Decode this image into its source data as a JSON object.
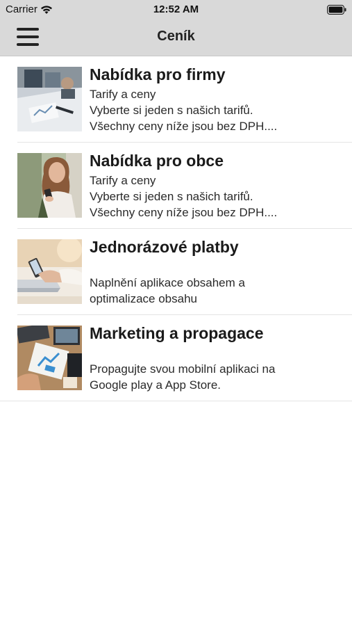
{
  "status_bar": {
    "carrier": "Carrier",
    "time": "12:52 AM"
  },
  "nav": {
    "title": "Ceník",
    "menu_icon": "hamburger-menu-icon"
  },
  "items": [
    {
      "title": "Nabídka pro firmy",
      "subtitle": "Tarify a ceny",
      "description": "Vyberte si jeden s našich tarifů.\nVšechny ceny níže jsou bez DPH...."
    },
    {
      "title": "Nabídka pro obce",
      "subtitle": "Tarify a ceny",
      "description": "Vyberte si jeden s našich tarifů.\nVšechny ceny níže jsou bez DPH...."
    },
    {
      "title": "Jednorázové platby",
      "subtitle": "",
      "description": "Naplnění aplikace obsahem a\noptimalizace obsahu"
    },
    {
      "title": "Marketing a propagace",
      "subtitle": "",
      "description": "Propagujte svou mobilní aplikaci na\nGoogle play a App Store."
    }
  ]
}
